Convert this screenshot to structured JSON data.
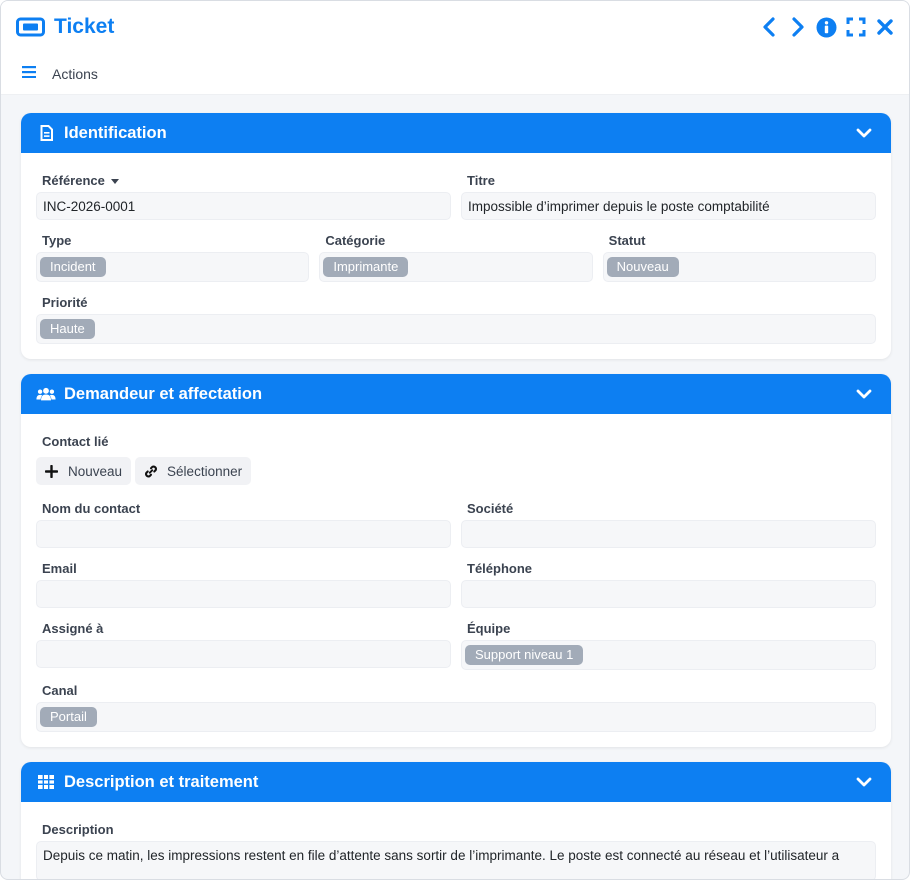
{
  "window": {
    "title": "Ticket",
    "icon": "ticket-icon",
    "controls": [
      "chevron-left-icon",
      "chevron-right-icon",
      "info-icon",
      "expand-icon",
      "close-icon"
    ]
  },
  "menubar": {
    "label": "Actions",
    "icon": "hamburger-icon"
  },
  "colors": {
    "accent": "#0d7ff2",
    "tag": "#a2abb8",
    "field_bg": "#f6f7f9"
  },
  "identification": {
    "title": "Identification",
    "icon": "document-icon",
    "reference_label": "Référence",
    "reference_value": "INC-2026-0001",
    "titre_label": "Titre",
    "titre_value": "Impossible d’imprimer depuis le poste comptabilité",
    "type_label": "Type",
    "type_value": "Incident",
    "categorie_label": "Catégorie",
    "categorie_value": "Imprimante",
    "statut_label": "Statut",
    "statut_value": "Nouveau",
    "priorite_label": "Priorité",
    "priorite_value": "Haute"
  },
  "demandeur": {
    "title": "Demandeur et affectation",
    "icon": "users-icon",
    "contact_label": "Contact lié",
    "new_button": "Nouveau",
    "select_button": "Sélectionner",
    "nom_label": "Nom du contact",
    "nom_value": "",
    "societe_label": "Société",
    "societe_value": "",
    "email_label": "Email",
    "email_value": "",
    "telephone_label": "Téléphone",
    "telephone_value": "",
    "assigne_label": "Assigné à",
    "assigne_value": "",
    "equipe_label": "Équipe",
    "equipe_value": "Support niveau 1",
    "canal_label": "Canal",
    "canal_value": "Portail"
  },
  "traitement": {
    "title": "Description et traitement",
    "icon": "grid-icon",
    "description_label": "Description",
    "description_value": "Depuis ce matin, les impressions restent en file d’attente sans sortir de l’imprimante. Le poste est connecté au réseau et l’utilisateur a"
  }
}
